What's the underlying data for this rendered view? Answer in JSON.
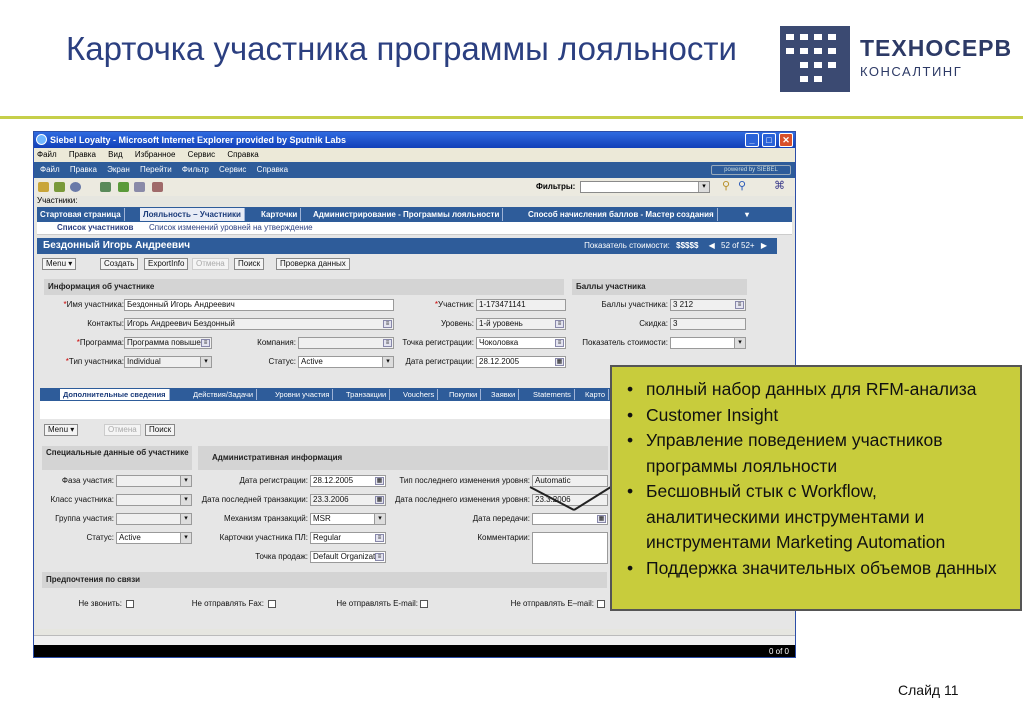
{
  "slide": {
    "title": "Карточка участника программы лояльности",
    "logo_line1": "ТЕХНОСЕРВ",
    "logo_line2": "КОНСАЛТИНГ",
    "slide_number": "Слайд 11"
  },
  "browser": {
    "title": "Siebel Loyalty - Microsoft Internet Explorer provided by Sputnik Labs",
    "menu": [
      "Файл",
      "Правка",
      "Вид",
      "Избранное",
      "Сервис",
      "Справка"
    ]
  },
  "siebel": {
    "app_menu": [
      "Файл",
      "Правка",
      "Экран",
      "Перейти",
      "Фильтр",
      "Сервис",
      "Справка"
    ],
    "powered_by": "powered by SIEBEL",
    "filter_label": "Фильтры:",
    "breadcrumb": "Участники:",
    "tabs": [
      "Стартовая страница",
      "Лояльность – Участники",
      "Карточки",
      "Администрирование - Программы лояльности",
      "Способ начисления баллов - Мастер создания"
    ],
    "subtabs": [
      "Список участников",
      "Список изменений уровней на утверждение"
    ],
    "record_title": "Бездонный Игорь Андреевич",
    "value_indicator_label": "Показатель стоимости:",
    "value_indicator": "$$$$$",
    "record_count": "52 of 52+",
    "buttons": {
      "menu": "Menu ▾",
      "create": "Создать",
      "export": "ExportInfo",
      "cancel": "Отмена",
      "search": "Поиск",
      "check": "Проверка данных"
    },
    "section_info": "Информация об участнике",
    "section_points": "Баллы участника",
    "fields": {
      "name_label": "Имя участника:",
      "name_value": "Бездонный Игорь Андреевич",
      "contacts_label": "Контакты:",
      "contacts_value": "Игорь Андреевич Бездонный",
      "program_label": "Программа:",
      "program_value": "Программа повыше",
      "type_label": "Тип участника:",
      "type_value": "Individual",
      "company_label": "Компания:",
      "status_label": "Статус:",
      "status_value": "Active",
      "member_label": "Участник:",
      "member_value": "1-173471141",
      "level_label": "Уровень:",
      "level_value": "1-й уровень",
      "regpoint_label": "Точка регистрации:",
      "regpoint_value": "Чоколовка",
      "regdate_label": "Дата регистрации:",
      "regdate_value": "28.12.2005",
      "points_label": "Баллы участника:",
      "points_value": "3 212",
      "discount_label": "Скидка:",
      "discount_value": "3",
      "valueind_label": "Показатель стоимости:"
    },
    "child_tabs": [
      "Дополнительные сведения",
      "Действия/Задачи",
      "Уровни участия",
      "Транзакции",
      "Vouchers",
      "Покупки",
      "Заявки",
      "Statements",
      "Карто"
    ],
    "child_buttons": {
      "menu": "Menu ▾",
      "cancel": "Отмена",
      "search": "Поиск"
    },
    "section_special": "Специальные данные об участнике",
    "section_admin": "Административная информация",
    "special": {
      "phase_label": "Фаза участия:",
      "class_label": "Класс участника:",
      "group_label": "Группа участия:",
      "status_label": "Статус:",
      "status_value": "Active"
    },
    "admin": {
      "regdate_label": "Дата регистрации:",
      "regdate_value": "28.12.2005",
      "lasttx_label": "Дата последней транзакции:",
      "lasttx_value": "23.3.2006",
      "mech_label": "Механизм транзакций:",
      "mech_value": "MSR",
      "cards_label": "Карточки участника ПЛ:",
      "cards_value": "Regular",
      "pos_label": "Точка продаж:",
      "pos_value": "Default Organizat",
      "lastlevel_type_label": "Тип последнего изменения уровня:",
      "lastlevel_type_value": "Automatic",
      "lastlevel_date_label": "Дата последнего изменения уровня:",
      "lastlevel_date_value": "23.3.2006",
      "transfer_label": "Дата передачи:",
      "comments_label": "Комментарии:"
    },
    "section_prefs": "Предпочтения по связи",
    "prefs": [
      "Не звонить:",
      "Не отправлять Fax:",
      "Не отправлять E-mail:",
      "Не отправлять E–mail:"
    ],
    "status_count": "0 of 0"
  },
  "callout": {
    "items": [
      "полный набор данных для RFM-анализа",
      "Customer Insight",
      "Управление поведением участников программы лояльности",
      "Бесшовный стык с Workflow, аналитическими инструментами и инструментами Marketing Automation",
      "Поддержка значительных объемов данных"
    ]
  },
  "colors": {
    "title_blue": "#2b3f80",
    "accent_green": "#c6cf4a",
    "callout_bg": "#c8cc3c",
    "siebel_blue": "#2e5c9a"
  }
}
